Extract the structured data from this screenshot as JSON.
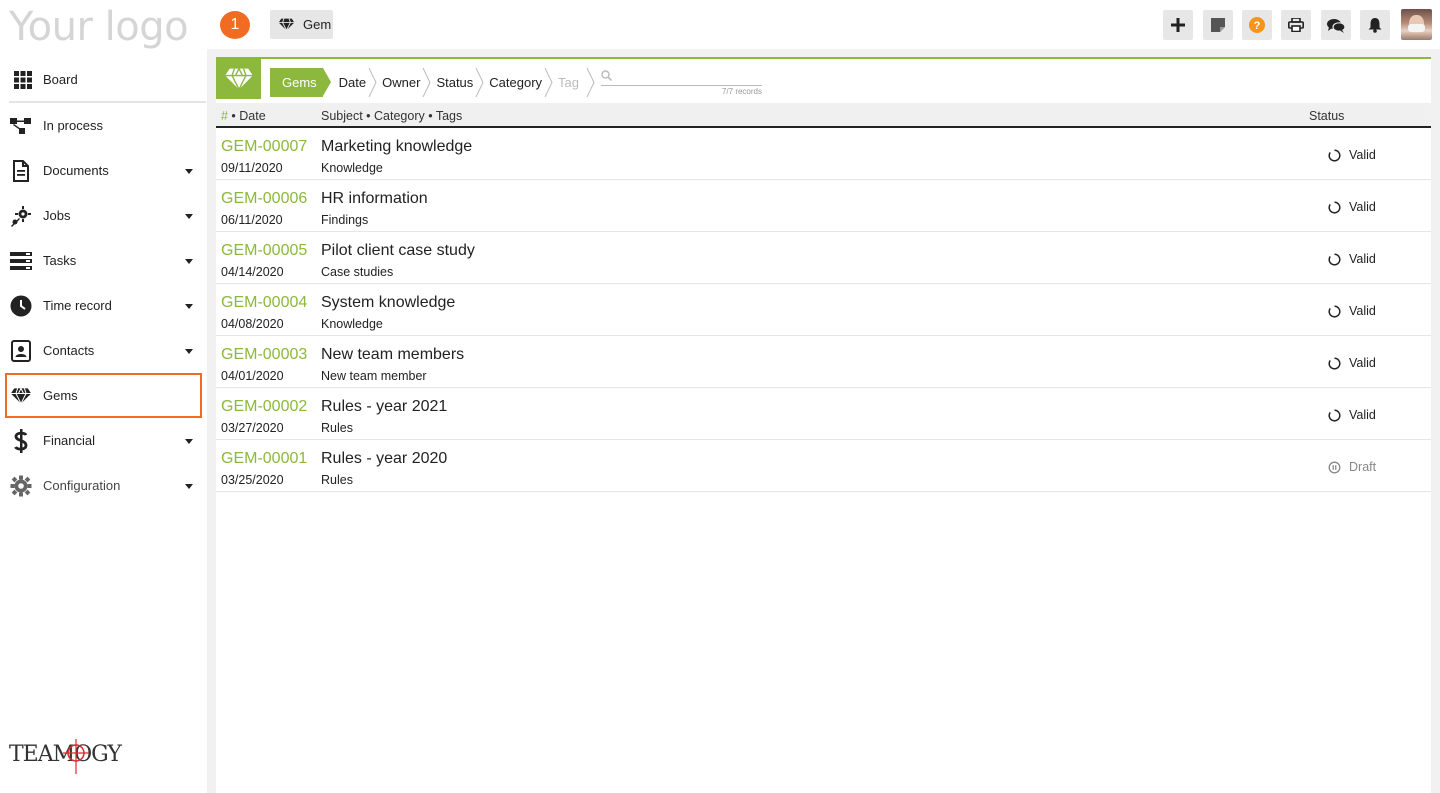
{
  "sidebar": {
    "logo": "Your logo",
    "items": [
      {
        "label": "Board",
        "icon": "grid-icon"
      },
      {
        "label": "In process",
        "icon": "flow-icon"
      },
      {
        "label": "Documents",
        "icon": "document-icon"
      },
      {
        "label": "Jobs",
        "icon": "jobs-icon"
      },
      {
        "label": "Tasks",
        "icon": "tasks-icon"
      },
      {
        "label": "Time record",
        "icon": "clock-icon"
      },
      {
        "label": "Contacts",
        "icon": "contacts-icon"
      },
      {
        "label": "Gems",
        "icon": "diamond-icon"
      },
      {
        "label": "Financial",
        "icon": "dollar-icon"
      },
      {
        "label": "Configuration",
        "icon": "gear-icon"
      }
    ],
    "brand": "TEAMOGY"
  },
  "topbar": {
    "notification_count": "1",
    "context_chip": "Gem",
    "buttons": [
      "plus-icon",
      "note-icon",
      "help-icon",
      "print-icon",
      "chat-icon",
      "bell-icon"
    ]
  },
  "colors": {
    "accent_green": "#8cb83d",
    "accent_orange": "#f26b22",
    "help_orange": "#f7941d"
  },
  "filters": {
    "crumbs": [
      "Gems",
      "Date",
      "Owner",
      "Status",
      "Category",
      "Tag"
    ],
    "records": "7/7 records"
  },
  "table": {
    "headers": {
      "hash": "#",
      "date": " • Date",
      "subject": "Subject • Category • Tags",
      "status": "Status"
    },
    "rows": [
      {
        "id": "GEM-00007",
        "date": "09/11/2020",
        "subject": "Marketing knowledge",
        "category": "Knowledge",
        "status": "Valid"
      },
      {
        "id": "GEM-00006",
        "date": "06/11/2020",
        "subject": "HR information",
        "category": "Findings",
        "status": "Valid"
      },
      {
        "id": "GEM-00005",
        "date": "04/14/2020",
        "subject": "Pilot client case study",
        "category": "Case studies",
        "status": "Valid"
      },
      {
        "id": "GEM-00004",
        "date": "04/08/2020",
        "subject": "System knowledge",
        "category": "Knowledge",
        "status": "Valid"
      },
      {
        "id": "GEM-00003",
        "date": "04/01/2020",
        "subject": "New team members",
        "category": "New team member",
        "status": "Valid"
      },
      {
        "id": "GEM-00002",
        "date": "03/27/2020",
        "subject": "Rules - year 2021",
        "category": "Rules",
        "status": "Valid"
      },
      {
        "id": "GEM-00001",
        "date": "03/25/2020",
        "subject": "Rules - year 2020",
        "category": "Rules",
        "status": "Draft"
      }
    ]
  }
}
